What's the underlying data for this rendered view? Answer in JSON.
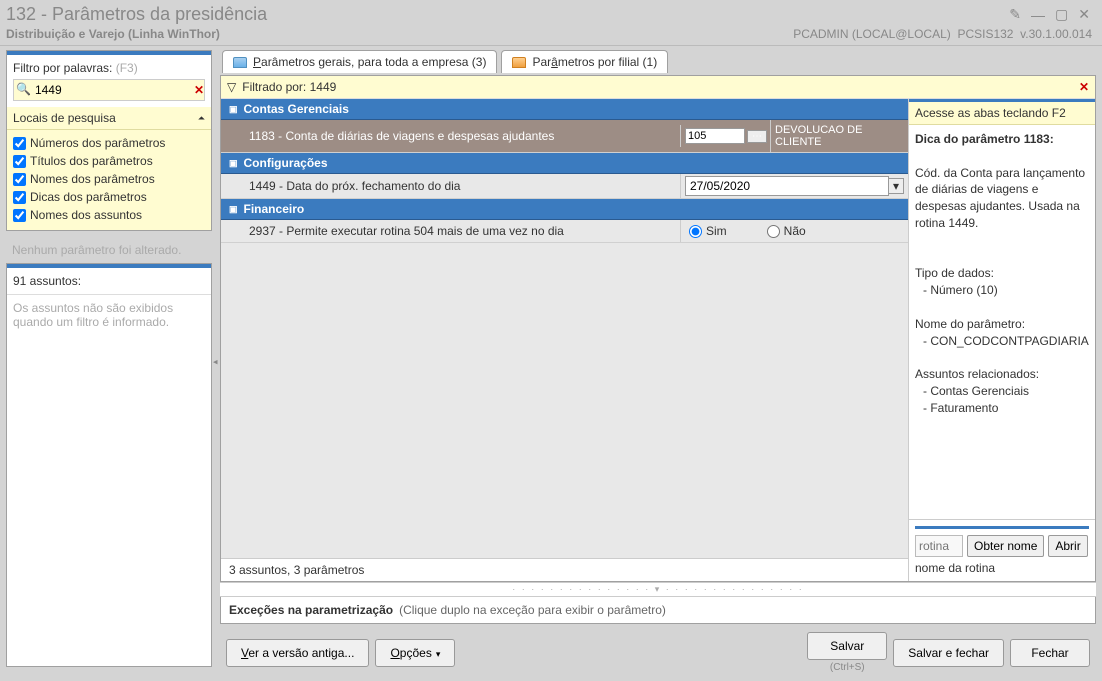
{
  "window": {
    "title": "132 - Parâmetros da presidência",
    "subtitle": "Distribuição e Varejo (Linha WinThor)",
    "user": "PCADMIN (LOCAL@LOCAL)",
    "module": "PCSIS132",
    "version": "v.30.1.00.014"
  },
  "filter": {
    "label": "Filtro por palavras:",
    "hint": "(F3)",
    "value": "1449"
  },
  "locais": {
    "title": "Locais de pesquisa",
    "items": [
      "Números dos parâmetros",
      "Títulos dos parâmetros",
      "Nomes dos parâmetros",
      "Dicas dos parâmetros",
      "Nomes dos assuntos"
    ]
  },
  "status_left": "Nenhum parâmetro foi alterado.",
  "assuntos": {
    "title": "91 assuntos:",
    "empty": "Os assuntos não são exibidos quando um filtro é informado."
  },
  "tabs": {
    "t1_prefix": "P",
    "t1_rest": "arâmetros gerais, para toda a empresa  (3)",
    "t2_prefix": "Par",
    "t2_ul": "â",
    "t2_rest": "metros por filial  (1)"
  },
  "filter_bar": {
    "label": "Filtrado por: 1449"
  },
  "groups": {
    "g1": "Contas Gerenciais",
    "g2": "Configurações",
    "g3": "Financeiro"
  },
  "rows": {
    "r1_desc": "1183 - Conta de diárias de viagens e despesas ajudantes",
    "r1_val": "105",
    "r1_extra": "DEVOLUCAO DE CLIENTE",
    "r2_desc": "1449 - Data do próx. fechamento do dia",
    "r2_val": "27/05/2020",
    "r3_desc": "2937 - Permite executar rotina 504 mais de uma vez no dia",
    "r3_yes": "Sim",
    "r3_no": "Não"
  },
  "grid_status": "3 assuntos, 3 parâmetros",
  "side": {
    "hint1": "Acesse as abas teclando F2",
    "title": "Dica do parâmetro 1183:",
    "body1": "Cód. da Conta para lançamento de diárias de viagens e despesas ajudantes. Usada na rotina 1449.",
    "tipo_hdr": "Tipo de dados:",
    "tipo_val": "- Número (10)",
    "nome_hdr": "Nome do parâmetro:",
    "nome_val": "- CON_CODCONTPAGDIARIA",
    "ass_hdr": "Assuntos relacionados:",
    "ass1": "- Contas Gerenciais",
    "ass2": "- Faturamento",
    "rotina_ph": "rotina",
    "obter": "Obter nome",
    "abrir": "Abrir",
    "rotina_lbl": "nome da rotina"
  },
  "excecoes": {
    "title": "Exceções na parametrização",
    "hint": "(Clique duplo na exceção para exibir o parâmetro)"
  },
  "footer": {
    "versao_ul": "V",
    "versao_rest": "er a versão antiga...",
    "opcoes_ul": "O",
    "opcoes_rest": "pções",
    "salvar": "Salvar",
    "salvar_fechar": "Salvar e fechar",
    "fechar": "Fechar",
    "shortcut": "(Ctrl+S)"
  }
}
